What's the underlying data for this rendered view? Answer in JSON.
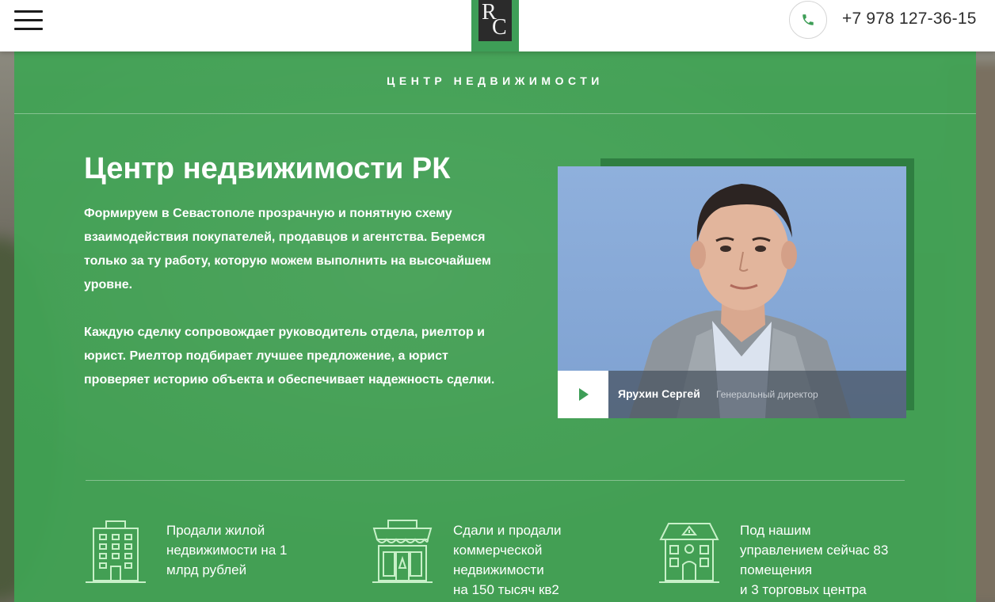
{
  "header": {
    "phone_number": "+7 978 127-36-15",
    "logo_text_r": "R",
    "logo_text_c": "C"
  },
  "panel": {
    "section_label": "ЦЕНТР НЕДВИЖИМОСТИ",
    "title": "Центр недвижимости РК",
    "paragraph1": "Формируем в Севастополе прозрачную и понятную схему взаимодействия покупателей, продавцов и агентства. Беремся только за ту работу, которую можем выполнить на высочайшем уровне.",
    "paragraph2": "Каждую сделку сопровождает руководитель отдела, риелтор и юрист. Риелтор подбирает лучшее предложение, а юрист проверяет историю объекта и обеспечивает надежность сделки."
  },
  "video": {
    "person_name": "Ярухин Сергей",
    "person_role": "Генеральный директор"
  },
  "stats": [
    {
      "icon": "apartment-building-icon",
      "text": "Продали жилой\nнедвижимости на 1\nмлрд рублей"
    },
    {
      "icon": "storefront-icon",
      "text": "Сдали и продали\nкоммерческой\nнедвижимости\nна 150 тысяч кв2"
    },
    {
      "icon": "house-icon",
      "text": "Под нашим\nуправлением сейчас 83\nпомещения\nи 3 торговых центра"
    }
  ],
  "colors": {
    "green_panel": "#3fa454",
    "accent_green": "#3e9e57",
    "icon_color": "#c8f0c8"
  }
}
